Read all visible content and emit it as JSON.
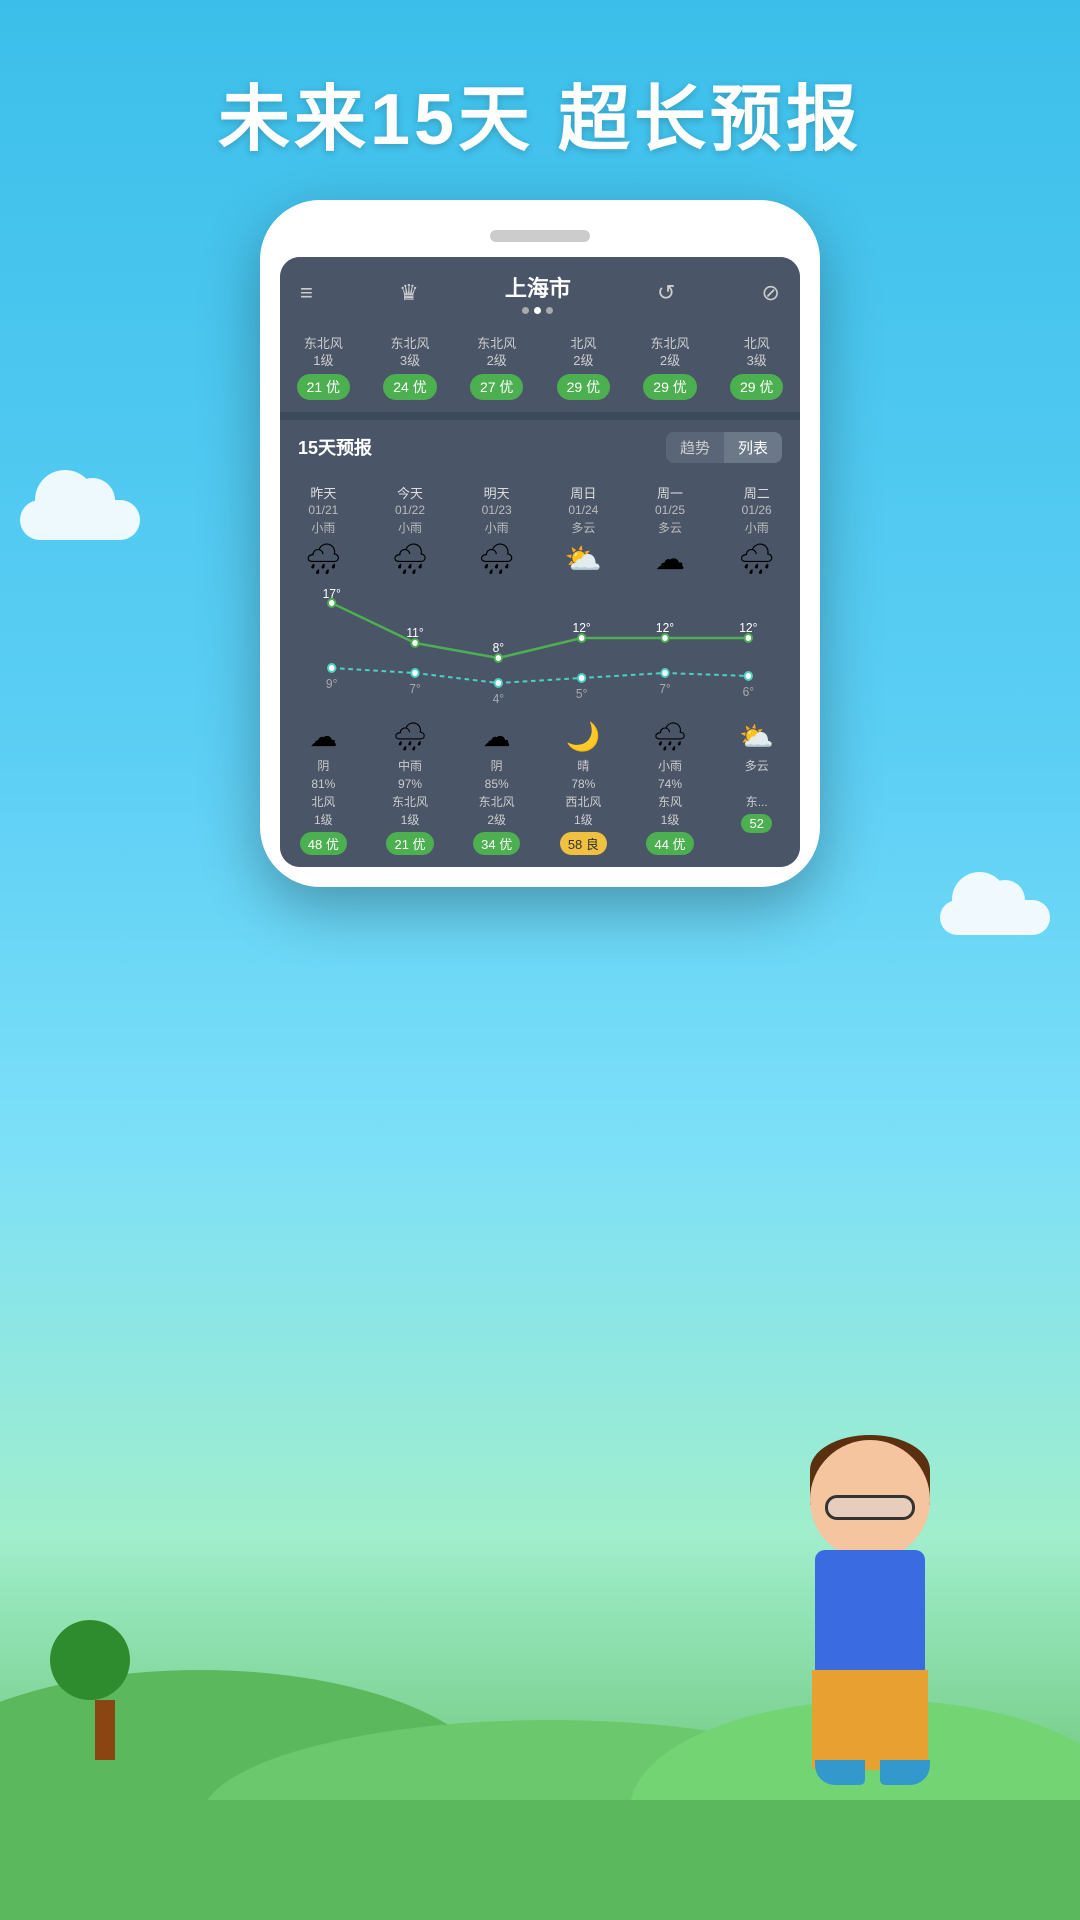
{
  "headline": "未来15天  超长预报",
  "background": {
    "color": "#3bbfea"
  },
  "phone": {
    "header": {
      "city": "上海市",
      "menu_icon": "≡",
      "crown_icon": "♛",
      "refresh_icon": "↺",
      "share_icon": "⊘",
      "dots": [
        false,
        true,
        false
      ]
    },
    "aqi_row": {
      "columns": [
        {
          "wind": "东北风\n1级",
          "aqi": "21 优",
          "type": "you"
        },
        {
          "wind": "东北风\n3级",
          "aqi": "24 优",
          "type": "you"
        },
        {
          "wind": "东北风\n2级",
          "aqi": "27 优",
          "type": "you"
        },
        {
          "wind": "北风\n2级",
          "aqi": "29 优",
          "type": "you"
        },
        {
          "wind": "东北风\n2级",
          "aqi": "29 优",
          "type": "you"
        },
        {
          "wind": "北风\n3级",
          "aqi": "29 优",
          "type": "you"
        }
      ]
    },
    "forecast_section": {
      "title": "15天预报",
      "tabs": [
        "趋势",
        "列表"
      ],
      "active_tab": 1
    },
    "days": [
      {
        "label": "昨天",
        "date": "01/21",
        "weather": "小雨",
        "icon": "🌧",
        "high": "17°",
        "low": "9°"
      },
      {
        "label": "今天",
        "date": "01/22",
        "weather": "小雨",
        "icon": "🌧",
        "high": "11°",
        "low": "7°"
      },
      {
        "label": "明天",
        "date": "01/23",
        "weather": "小雨",
        "icon": "🌧",
        "high": "8°",
        "low": "4°"
      },
      {
        "label": "周日",
        "date": "01/24",
        "weather": "多云",
        "icon": "⛅",
        "high": "12°",
        "low": "5°"
      },
      {
        "label": "周一",
        "date": "01/25",
        "weather": "多云",
        "icon": "☁",
        "high": "12°",
        "low": "7°"
      },
      {
        "label": "周二",
        "date": "01/26",
        "weather": "小雨",
        "icon": "🌧",
        "high": "12°",
        "low": "6°"
      }
    ],
    "bottom_days": [
      {
        "icon": "☁",
        "weather": "阴",
        "humidity": "81%",
        "wind": "北风\n1级",
        "aqi": "48 优",
        "aqi_type": "you"
      },
      {
        "icon": "🌧",
        "weather": "中雨",
        "humidity": "97%",
        "wind": "东北风\n1级",
        "aqi": "21 优",
        "aqi_type": "you"
      },
      {
        "icon": "☁",
        "weather": "阴",
        "humidity": "85%",
        "wind": "东北风\n2级",
        "aqi": "34 优",
        "aqi_type": "you"
      },
      {
        "icon": "🌙",
        "weather": "晴",
        "humidity": "78%",
        "wind": "西北风\n1级",
        "aqi": "58 良",
        "aqi_type": "liang"
      },
      {
        "icon": "🌧",
        "weather": "小雨",
        "humidity": "74%",
        "wind": "东风\n1级",
        "aqi": "44 优",
        "aqi_type": "you"
      },
      {
        "icon": "⛅",
        "weather": "多云",
        "humidity": "",
        "wind": "东...",
        "aqi": "52",
        "aqi_type": "you"
      }
    ]
  }
}
